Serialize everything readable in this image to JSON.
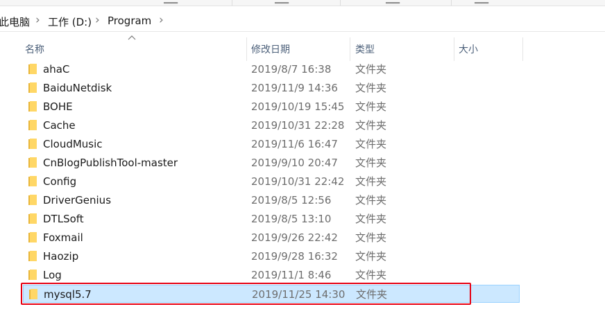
{
  "breadcrumb": {
    "items": [
      "此电脑",
      "工作 (D:)",
      "Program"
    ]
  },
  "columns": {
    "name": "名称",
    "date": "修改日期",
    "type": "类型",
    "size": "大小"
  },
  "files": [
    {
      "name": "ahaC",
      "date": "2019/8/7 16:38",
      "type": "文件夹"
    },
    {
      "name": "BaiduNetdisk",
      "date": "2019/11/9 14:36",
      "type": "文件夹"
    },
    {
      "name": "BOHE",
      "date": "2019/10/19 15:45",
      "type": "文件夹"
    },
    {
      "name": "Cache",
      "date": "2019/10/31 22:28",
      "type": "文件夹"
    },
    {
      "name": "CloudMusic",
      "date": "2019/11/6 16:47",
      "type": "文件夹"
    },
    {
      "name": "CnBlogPublishTool-master",
      "date": "2019/9/10 20:47",
      "type": "文件夹"
    },
    {
      "name": "Config",
      "date": "2019/10/31 22:42",
      "type": "文件夹"
    },
    {
      "name": "DriverGenius",
      "date": "2019/8/5 12:56",
      "type": "文件夹"
    },
    {
      "name": "DTLSoft",
      "date": "2019/8/5 13:10",
      "type": "文件夹"
    },
    {
      "name": "Foxmail",
      "date": "2019/9/26 22:42",
      "type": "文件夹"
    },
    {
      "name": "Haozip",
      "date": "2019/9/28 16:32",
      "type": "文件夹"
    },
    {
      "name": "Log",
      "date": "2019/11/1 8:46",
      "type": "文件夹"
    },
    {
      "name": "mysql5.7",
      "date": "2019/11/25 14:30",
      "type": "文件夹"
    }
  ],
  "selected_index": 12,
  "colors": {
    "selection": "#cce8ff",
    "highlight_border": "#e60012",
    "folder": "#ffd766"
  }
}
